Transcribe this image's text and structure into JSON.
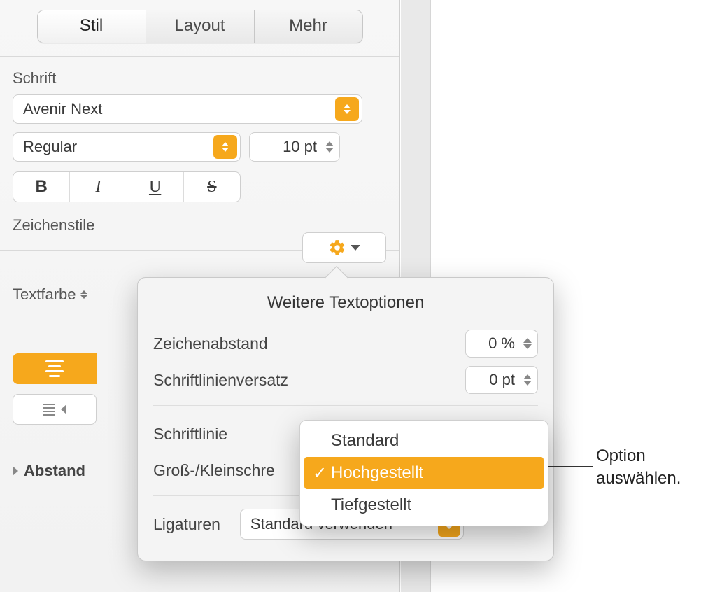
{
  "tabs": {
    "style": "Stil",
    "layout": "Layout",
    "more": "Mehr"
  },
  "font": {
    "section": "Schrift",
    "family": "Avenir Next",
    "weight": "Regular",
    "size": "10 pt"
  },
  "charStyles": "Zeichenstile",
  "textColor": "Textfarbe",
  "spacing": "Abstand",
  "popover": {
    "title": "Weitere Textoptionen",
    "charSpacingLabel": "Zeichenabstand",
    "charSpacingValue": "0 %",
    "baselineLabel": "Schriftlinienversatz",
    "baselineValue": "0 pt",
    "fontLineLabel": "Schriftlinie",
    "capsLabel": "Groß-/Kleinschre",
    "ligaturesLabel": "Ligaturen",
    "ligaturesValue": "Standard verwenden"
  },
  "menu": {
    "standard": "Standard",
    "superscript": "Hochgestellt",
    "subscript": "Tiefgestellt"
  },
  "callout": {
    "l1": "Option",
    "l2": "auswählen."
  }
}
